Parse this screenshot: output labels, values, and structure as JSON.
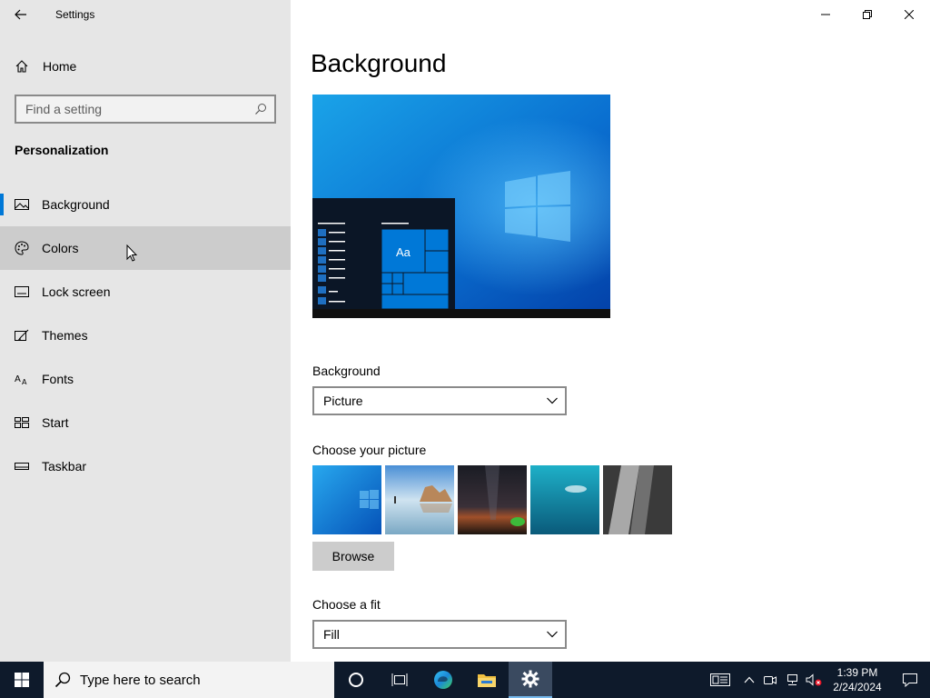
{
  "app": {
    "title": "Settings"
  },
  "sidebar": {
    "home_label": "Home",
    "search_placeholder": "Find a setting",
    "section_title": "Personalization",
    "items": [
      {
        "label": "Background",
        "icon": "image-icon",
        "selected": true
      },
      {
        "label": "Colors",
        "icon": "palette-icon",
        "hover": true
      },
      {
        "label": "Lock screen",
        "icon": "lock-screen-icon"
      },
      {
        "label": "Themes",
        "icon": "themes-icon"
      },
      {
        "label": "Fonts",
        "icon": "fonts-icon"
      },
      {
        "label": "Start",
        "icon": "start-icon"
      },
      {
        "label": "Taskbar",
        "icon": "taskbar-icon"
      }
    ]
  },
  "main": {
    "title": "Background",
    "preview_sample_text": "Aa",
    "background_label": "Background",
    "background_value": "Picture",
    "choose_picture_label": "Choose your picture",
    "browse_label": "Browse",
    "fit_label": "Choose a fit",
    "fit_value": "Fill"
  },
  "taskbar": {
    "search_placeholder": "Type here to search",
    "clock_time": "1:39 PM",
    "clock_date": "2/24/2024"
  },
  "colors": {
    "accent": "#0078d7",
    "sidebar_bg": "#e6e6e6",
    "taskbar_bg": "#0e1a2b"
  }
}
